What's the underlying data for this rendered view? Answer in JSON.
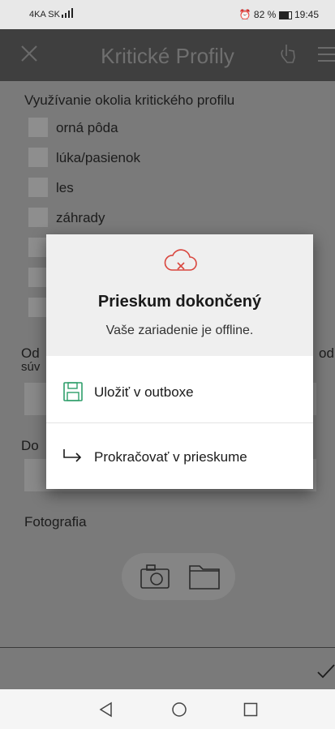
{
  "status_bar": {
    "carrier": "4KA SK",
    "battery": "82 %",
    "time": "19:45"
  },
  "header": {
    "title": "Kritické Profily"
  },
  "content": {
    "section_title": "Využívanie okolia kritického profilu",
    "options": [
      "orná pôda",
      "lúka/pasienok",
      "les",
      "záhrady"
    ],
    "od_label_left": "Od",
    "od_label_right": "od",
    "suv_label": "súv",
    "do_label": "Do",
    "photo_label": "Fotografia"
  },
  "dialog": {
    "title": "Prieskum dokončený",
    "message": "Vaše zariadenie je offline.",
    "actions": [
      {
        "label": "Uložiť v outboxe",
        "icon": "floppy-disk-icon"
      },
      {
        "label": "Prokračovať v prieskume",
        "icon": "arrow-return-icon"
      }
    ]
  }
}
